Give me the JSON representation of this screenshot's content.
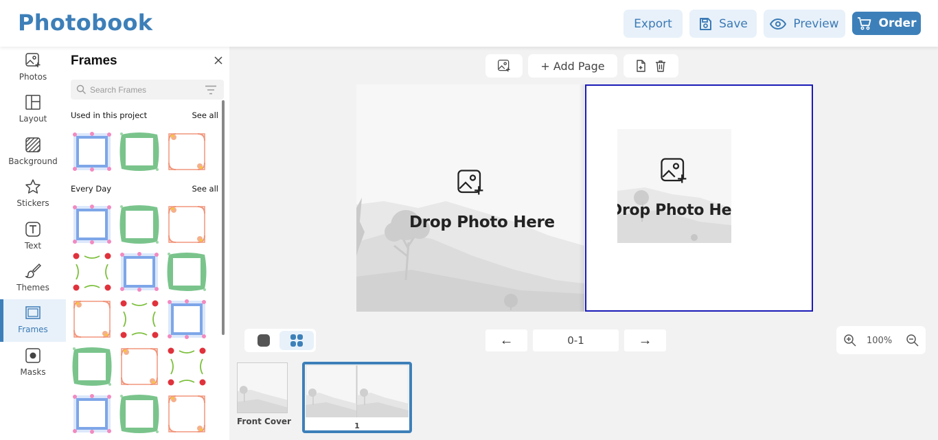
{
  "app": {
    "title": "Photobook"
  },
  "toolbar": {
    "export": "Export",
    "save": "Save",
    "preview": "Preview",
    "order": "Order"
  },
  "sidebar": {
    "items": [
      {
        "label": "Photos",
        "icon": "photo-add-icon"
      },
      {
        "label": "Layout",
        "icon": "layout-icon"
      },
      {
        "label": "Background",
        "icon": "background-icon"
      },
      {
        "label": "Stickers",
        "icon": "star-icon"
      },
      {
        "label": "Text",
        "icon": "text-icon"
      },
      {
        "label": "Themes",
        "icon": "brush-icon"
      },
      {
        "label": "Frames",
        "icon": "frame-icon",
        "active": true
      },
      {
        "label": "Masks",
        "icon": "mask-icon"
      }
    ]
  },
  "panel": {
    "title": "Frames",
    "search_placeholder": "Search Frames",
    "sections": [
      {
        "title": "Used in this project",
        "see_all": "See all"
      },
      {
        "title": "Every Day",
        "see_all": "See all"
      }
    ]
  },
  "canvas": {
    "add_page": "+ Add Page",
    "drop_left": "Drop Photo Here",
    "drop_right": "Drop Photo Here"
  },
  "pager": {
    "prev": "←",
    "current": "0-1",
    "next": "→"
  },
  "zoom": {
    "level": "100%"
  },
  "thumbnails": [
    {
      "label": "Front Cover"
    },
    {
      "label": "1"
    }
  ],
  "colors": {
    "accent": "#3d80b9",
    "accent_light": "#e8f1fa",
    "selection": "#1a1ab8"
  }
}
